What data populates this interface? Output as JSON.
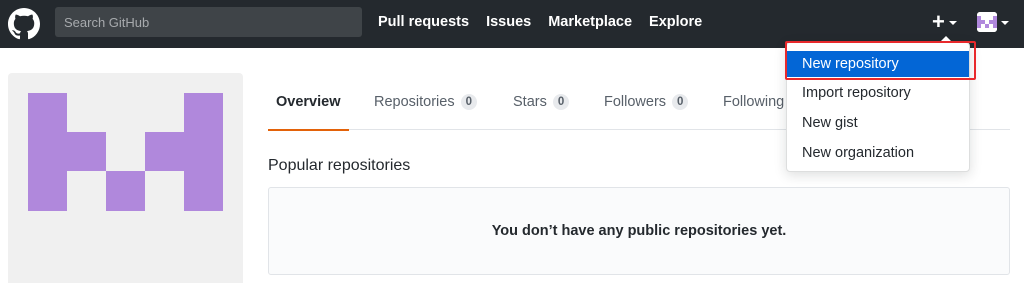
{
  "header": {
    "logo_icon": "github-octocat-icon",
    "search_placeholder": "Search GitHub",
    "nav": [
      {
        "label": "Pull requests"
      },
      {
        "label": "Issues"
      },
      {
        "label": "Marketplace"
      },
      {
        "label": "Explore"
      }
    ],
    "plus_label": "+",
    "plus_icon": "plus-icon",
    "avatar_icon": "avatar-icon",
    "background": "#24292e"
  },
  "profile": {
    "avatar_icon": "identicon-avatar",
    "avatar_color": "#b088dc"
  },
  "tabs": [
    {
      "label": "Overview",
      "count": null,
      "selected": true
    },
    {
      "label": "Repositories",
      "count": "0"
    },
    {
      "label": "Stars",
      "count": "0"
    },
    {
      "label": "Followers",
      "count": "0"
    },
    {
      "label": "Following",
      "count": null
    }
  ],
  "popular": {
    "title": "Popular repositories",
    "empty_message": "You don’t have any public repositories yet."
  },
  "dropdown": {
    "items": [
      {
        "label": "New repository",
        "active": true
      },
      {
        "label": "Import repository"
      },
      {
        "label": "New gist"
      },
      {
        "label": "New organization"
      }
    ],
    "accent": "#0366d6",
    "highlight_color": "#e8292c"
  }
}
